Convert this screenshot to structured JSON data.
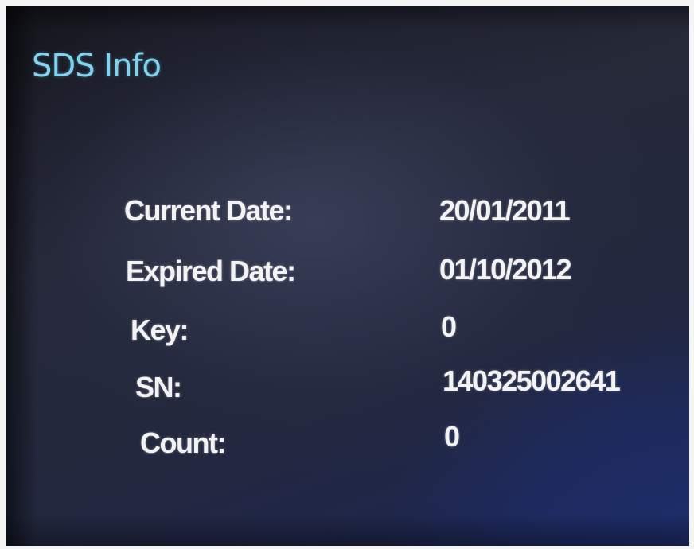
{
  "screen": {
    "title": "SDS Info",
    "colors": {
      "title": "#7fd3ef",
      "text": "#f3f3f3",
      "background": "#23283e"
    }
  },
  "info_rows": [
    {
      "label": "Current Date:",
      "value": "20/01/2011"
    },
    {
      "label": "Expired Date:",
      "value": "01/10/2012"
    },
    {
      "label": "Key:",
      "value": "0"
    },
    {
      "label": "SN:",
      "value": "140325002641"
    },
    {
      "label": "Count:",
      "value": "0"
    }
  ]
}
